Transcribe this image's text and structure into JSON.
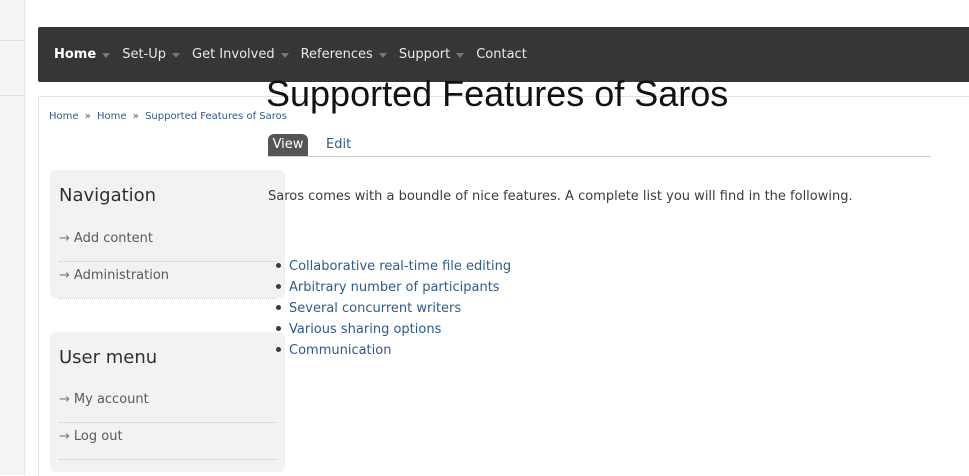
{
  "nav": {
    "items": [
      {
        "label": "Home",
        "has_dropdown": true,
        "active": true
      },
      {
        "label": "Set-Up",
        "has_dropdown": true,
        "active": false
      },
      {
        "label": "Get Involved",
        "has_dropdown": true,
        "active": false
      },
      {
        "label": "References",
        "has_dropdown": true,
        "active": false
      },
      {
        "label": "Support",
        "has_dropdown": true,
        "active": false
      },
      {
        "label": "Contact",
        "has_dropdown": false,
        "active": false
      }
    ]
  },
  "breadcrumb": {
    "items": [
      "Home",
      "Home",
      "Supported Features of Saros"
    ],
    "separator": "»"
  },
  "sidebar": {
    "navigation": {
      "title": "Navigation",
      "items": [
        "Add content",
        "Administration"
      ]
    },
    "user_menu": {
      "title": "User menu",
      "items": [
        "My account",
        "Log out"
      ]
    },
    "arrow_glyph": "→"
  },
  "main": {
    "title": "Supported Features of Saros",
    "tabs": {
      "view": "View",
      "edit": "Edit"
    },
    "intro": "Saros comes with a boundle of nice features. A complete list you will find in the following.",
    "features": [
      "Collaborative real-time file editing",
      "Arbitrary number of participants",
      "Several concurrent writers",
      "Various sharing options",
      "Communication"
    ]
  },
  "colors": {
    "navbar_bg": "#363636",
    "link": "#2f5b8a",
    "tab_active_bg": "#555555",
    "block_bg": "#f2f2f2"
  }
}
